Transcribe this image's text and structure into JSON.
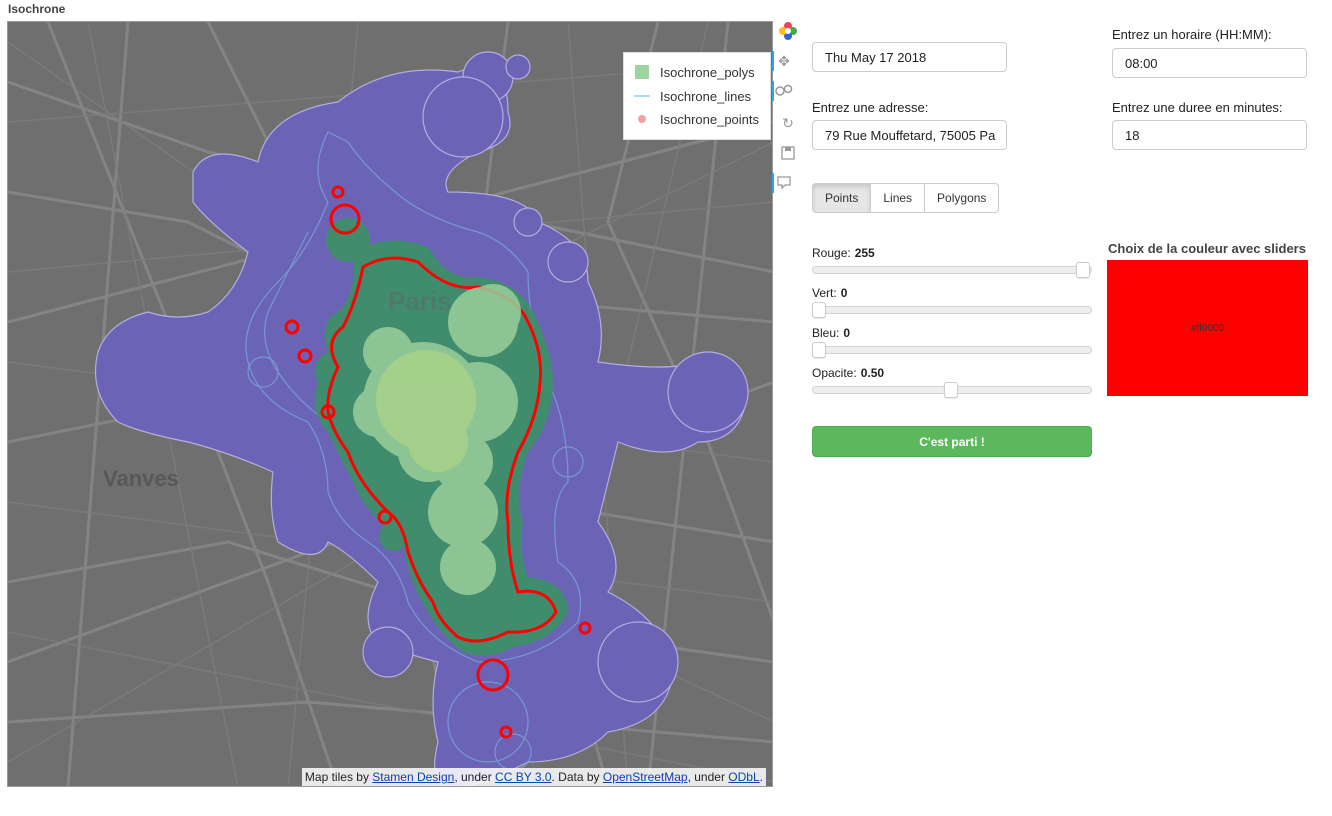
{
  "title": "Isochrone",
  "map": {
    "legend": [
      {
        "label": "Isochrone_polys",
        "swatch": "#9fd39f"
      },
      {
        "label": "Isochrone_lines",
        "swatch": "#a9dcef"
      },
      {
        "label": "Isochrone_points",
        "swatch": "#f4a0a0"
      }
    ],
    "place_labels": {
      "paris": "Paris",
      "vanves": "Vanves"
    },
    "attribution": {
      "prefix": "Map tiles by ",
      "link1": "Stamen Design",
      "mid1": ", under ",
      "link2": "CC BY 3.0",
      "mid2": ". Data by ",
      "link3": "OpenStreetMap",
      "mid3": ", under ",
      "link4": "ODbL",
      "suffix": "."
    },
    "colors": {
      "outer_poly": "#6b63b5",
      "mid_poly": "#3e8f6a",
      "inner_poly": "#9acf9a",
      "points": "#ff0000"
    }
  },
  "toolbar": {
    "icons": [
      "bokeh-logo-icon",
      "pan-icon",
      "wheel-zoom-icon",
      "reset-icon",
      "save-icon",
      "hover-icon"
    ]
  },
  "form": {
    "date_value": "Thu May 17 2018",
    "time_label": "Entrez un horaire (HH:MM):",
    "time_value": "08:00",
    "address_label": "Entrez une adresse:",
    "address_value": "79 Rue Mouffetard, 75005 Pa",
    "duration_label": "Entrez une duree en minutes:",
    "duration_value": "18",
    "modes": [
      {
        "label": "Points",
        "active": true
      },
      {
        "label": "Lines",
        "active": false
      },
      {
        "label": "Polygons",
        "active": false
      }
    ]
  },
  "sliders": {
    "red": {
      "label": "Rouge:",
      "value": "255",
      "fraction": 1.0
    },
    "green": {
      "label": "Vert:",
      "value": "0",
      "fraction": 0.0
    },
    "blue": {
      "label": "Bleu:",
      "value": "0",
      "fraction": 0.0
    },
    "opacity": {
      "label": "Opacite:",
      "value": "0.50",
      "fraction": 0.5
    }
  },
  "submit_label": "C'est parti !",
  "color_picker": {
    "title": "Choix de la couleur avec sliders",
    "hex": "#ff0000",
    "swatch": "#ff0000"
  }
}
